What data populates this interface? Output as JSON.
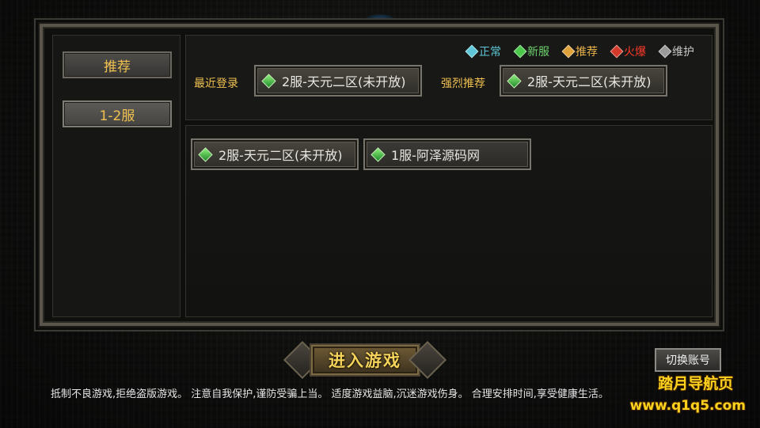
{
  "sidebar": {
    "items": [
      {
        "label": "推荐"
      },
      {
        "label": "1-2服"
      }
    ]
  },
  "legend": [
    {
      "label": "正常",
      "color": "#5ec8d8",
      "text_color": "#5ec8d8"
    },
    {
      "label": "新服",
      "color": "#4cc94c",
      "text_color": "#6ed36e"
    },
    {
      "label": "推荐",
      "color": "#e0a23a",
      "text_color": "#e8b24a"
    },
    {
      "label": "火爆",
      "color": "#d33a2a",
      "text_color": "#ff3a2a"
    },
    {
      "label": "维护",
      "color": "#9a9a9a",
      "text_color": "#c8c8c8"
    }
  ],
  "recent": {
    "label": "最近登录",
    "server": "2服-天元二区(未开放)"
  },
  "recommended": {
    "label": "强烈推荐",
    "server": "2服-天元二区(未开放)"
  },
  "server_list": [
    {
      "name": "2服-天元二区(未开放)"
    },
    {
      "name": "1服-阿泽源码网"
    }
  ],
  "enter_button": {
    "label": "进入游戏"
  },
  "switch_account_button": {
    "label": "切换账号"
  },
  "notice": "抵制不良游戏,拒绝盗版游戏。 注意自我保护,谨防受骗上当。 适度游戏益脑,沉迷游戏伤身。 合理安排时间,享受健康生活。",
  "watermark": {
    "line1": "踏月导航页",
    "line2": "www.q1q5.com"
  }
}
